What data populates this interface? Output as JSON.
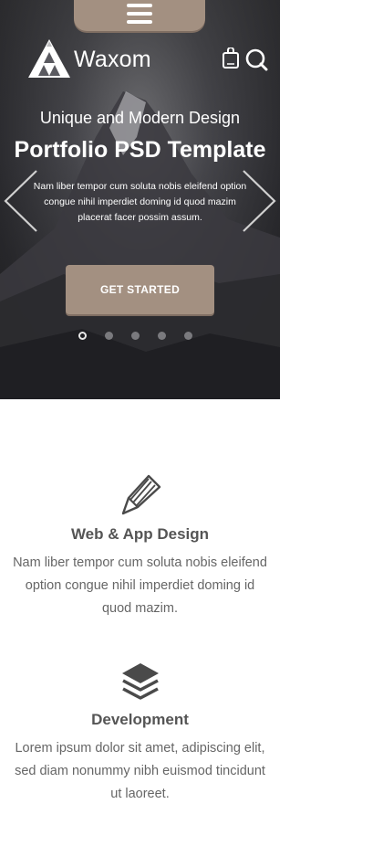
{
  "brand": {
    "name": "Waxom"
  },
  "header": {
    "menu_icon": "hamburger-icon",
    "cart_icon": "shopping-bag-icon",
    "search_icon": "search-icon"
  },
  "hero": {
    "subtitle": "Unique and Modern Design",
    "title": "Portfolio PSD Template",
    "description": "Nam liber tempor cum soluta nobis eleifend option congue nihil imperdiet doming id quod mazim placerat facer possim assum.",
    "cta_label": "GET STARTED",
    "slides": {
      "count": 5,
      "active": 1
    }
  },
  "features": [
    {
      "icon": "pen-icon",
      "title": "Web & App Design",
      "text": "Nam liber tempor cum soluta nobis eleifend option congue nihil imperdiet doming id quod mazim."
    },
    {
      "icon": "layers-icon",
      "title": "Development",
      "text": "Lorem ipsum dolor sit amet, adipiscing elit, sed diam nonummy nibh euismod tincidunt ut laoreet."
    }
  ],
  "colors": {
    "accent": "#a39081",
    "heading": "#555555",
    "body_text": "#666666"
  }
}
